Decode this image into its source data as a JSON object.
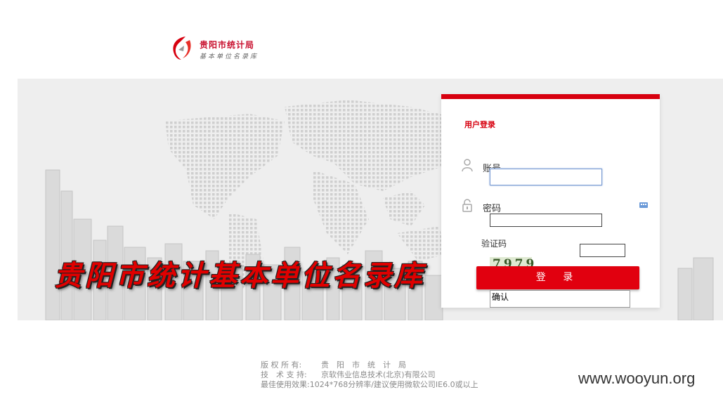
{
  "logo": {
    "title": "贵阳市统计局",
    "subtitle": "基本单位名录库",
    "icon": "guiyang-stats-logo-icon"
  },
  "banner": {
    "title": "贵阳市统计基本单位名录库",
    "background": "#eeeeee"
  },
  "login": {
    "panel_title": "用户登录",
    "account_label": "账号",
    "password_label": "密码",
    "code_label": "验证码",
    "account_value": "",
    "password_value": "",
    "code_value": "",
    "captcha_text": "7979",
    "login_button": "登 录",
    "confirm_text": "确认",
    "accent": "#d7000f"
  },
  "footer": {
    "copyright_key": "版 权 所 有:",
    "copyright_value": "贵　阳　市　统　计　局",
    "support_key": "技　术 支 持:",
    "support_value": "京软伟业信息技术(北京)有限公司",
    "best_view": "最佳使用效果:1024*768分辨率/建议使用微软公司IE6.0或以上"
  },
  "watermark": "www.wooyun.org"
}
